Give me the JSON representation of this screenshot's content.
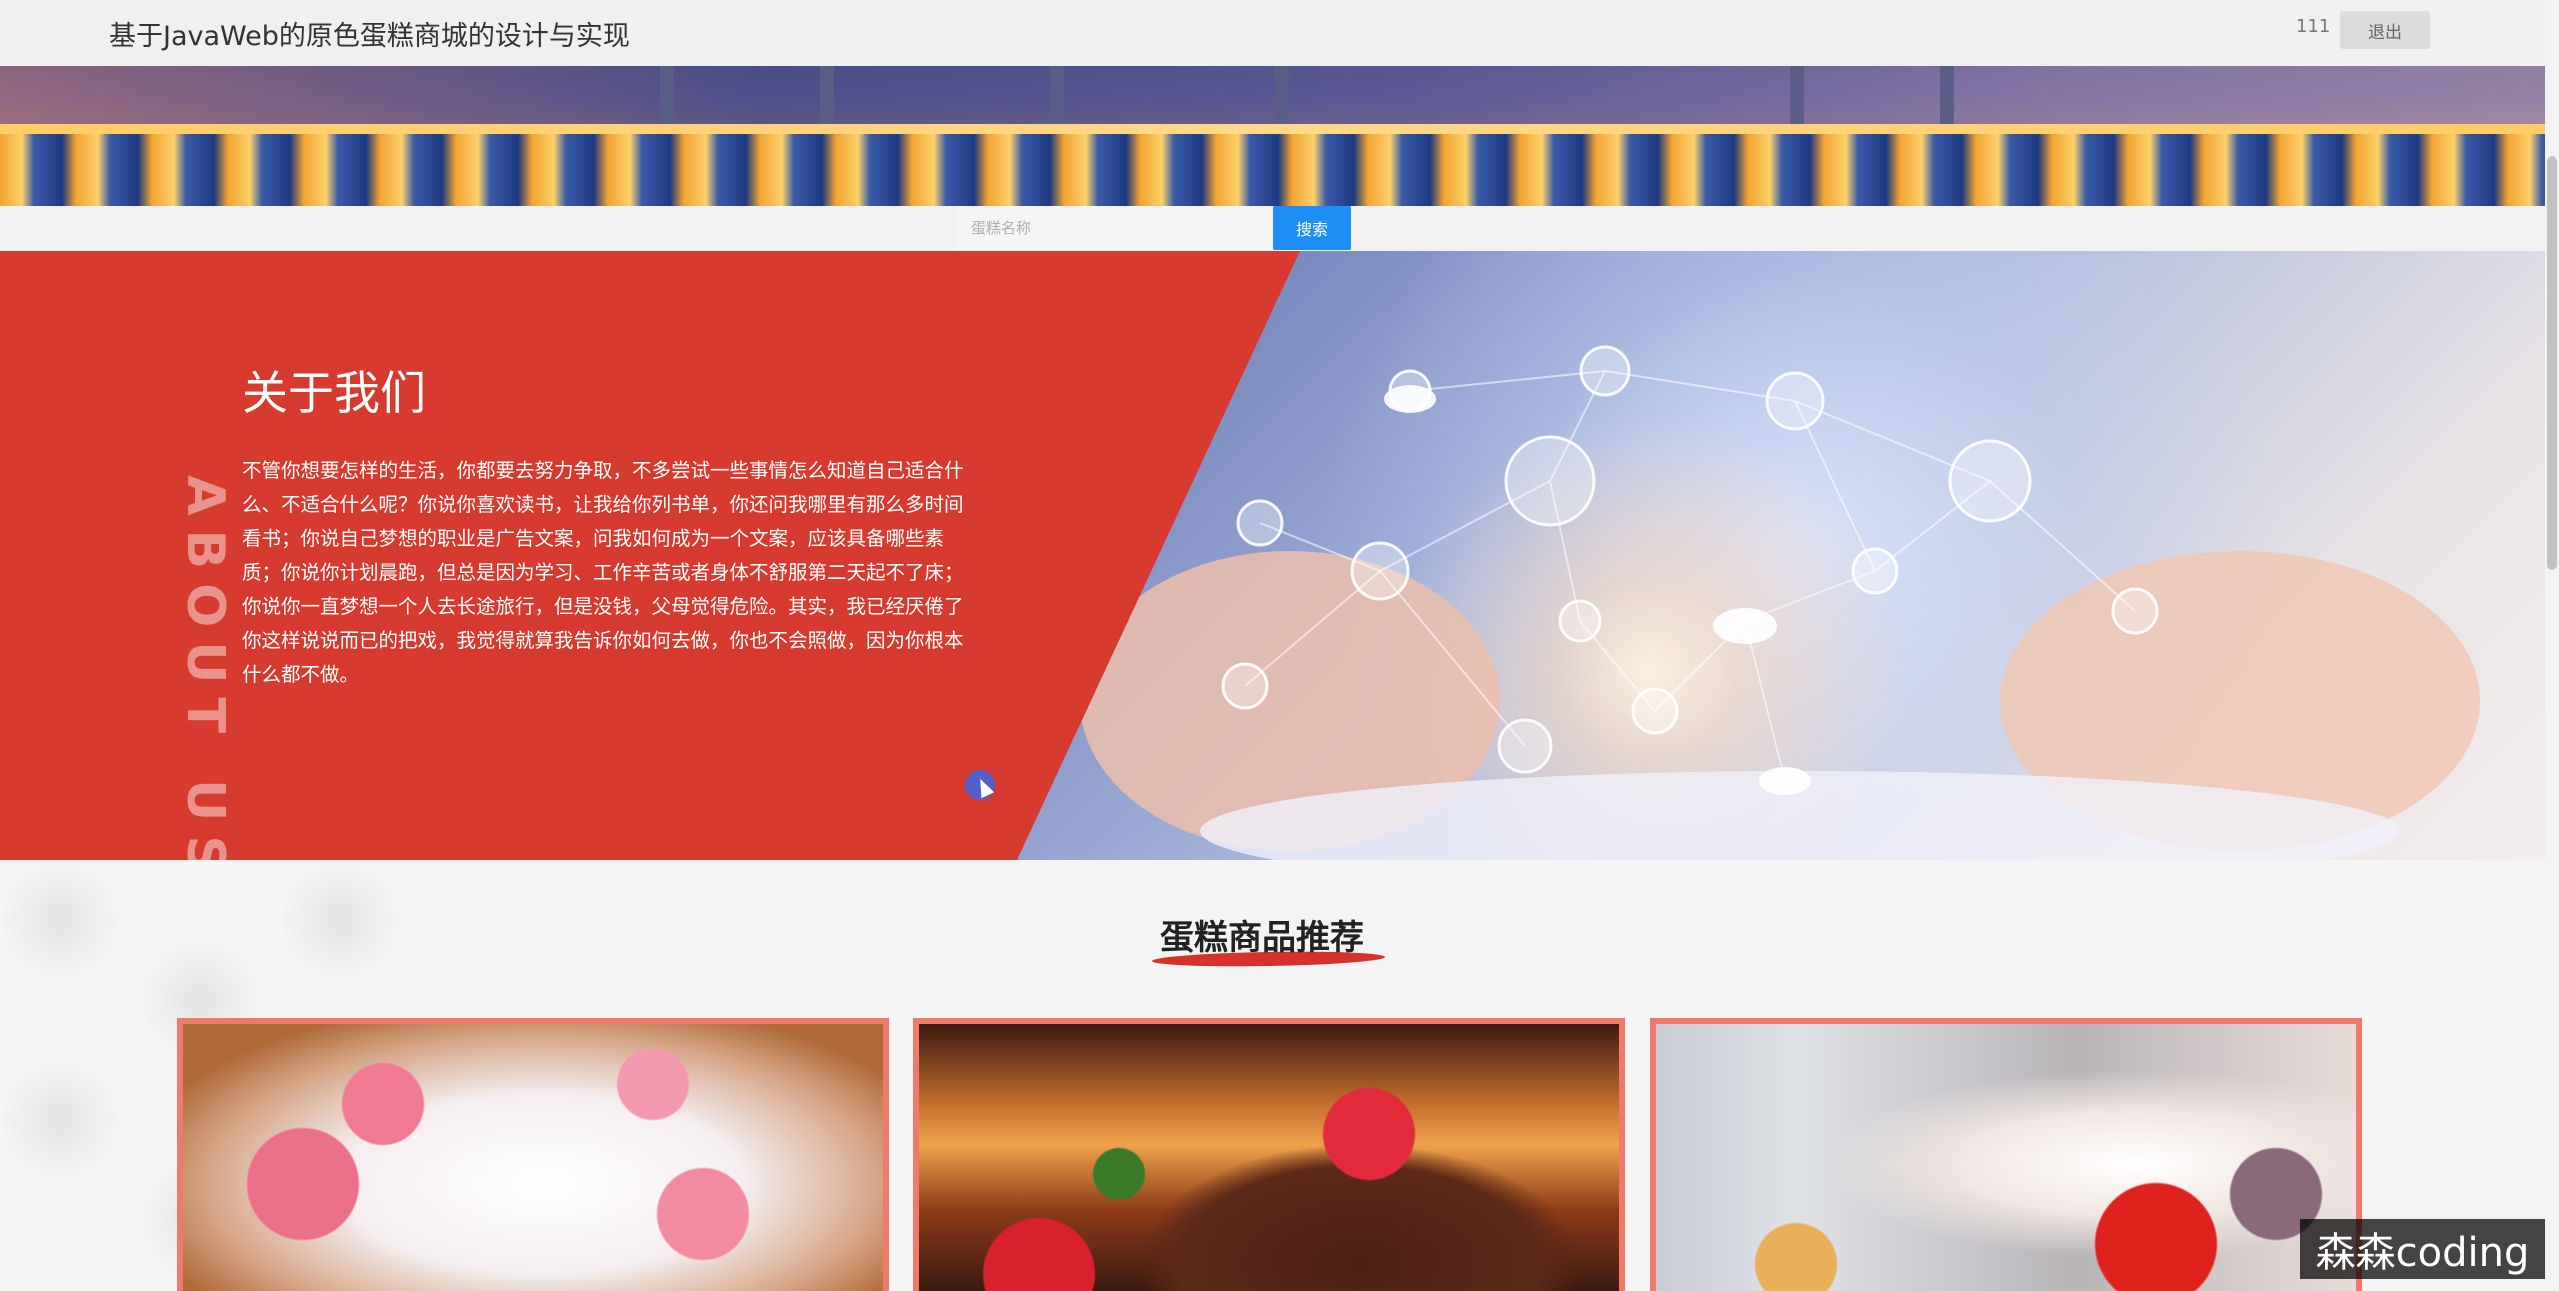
{
  "header": {
    "site_title": "基于JavaWeb的原色蛋糕商城的设计与实现",
    "username": "111",
    "logout_label": "退出"
  },
  "search": {
    "placeholder": "蛋糕名称",
    "button_label": "搜索"
  },
  "about": {
    "vertical_label": "ABOUT US",
    "title": "关于我们",
    "body": "不管你想要怎样的生活，你都要去努力争取，不多尝试一些事情怎么知道自己适合什么、不适合什么呢？你说你喜欢读书，让我给你列书单，你还问我哪里有那么多时间看书；你说自己梦想的职业是广告文案，问我如何成为一个文案，应该具备哪些素质；你说你计划晨跑，但总是因为学习、工作辛苦或者身体不舒服第二天起不了床；你说你一直梦想一个人去长途旅行，但是没钱，父母觉得危险。其实，我已经厌倦了你这样说说而已的把戏，我觉得就算我告诉你如何去做，你也不会照做，因为你根本什么都不做。"
  },
  "recommend": {
    "section_title": "蛋糕商品推荐"
  },
  "watermark": {
    "text": "森森coding"
  },
  "colors": {
    "accent_red": "#d73b2f",
    "search_blue": "#1e8ef7",
    "card_border": "#ef7a6c"
  },
  "icons": {
    "cursor": "mouse-cursor-icon"
  }
}
